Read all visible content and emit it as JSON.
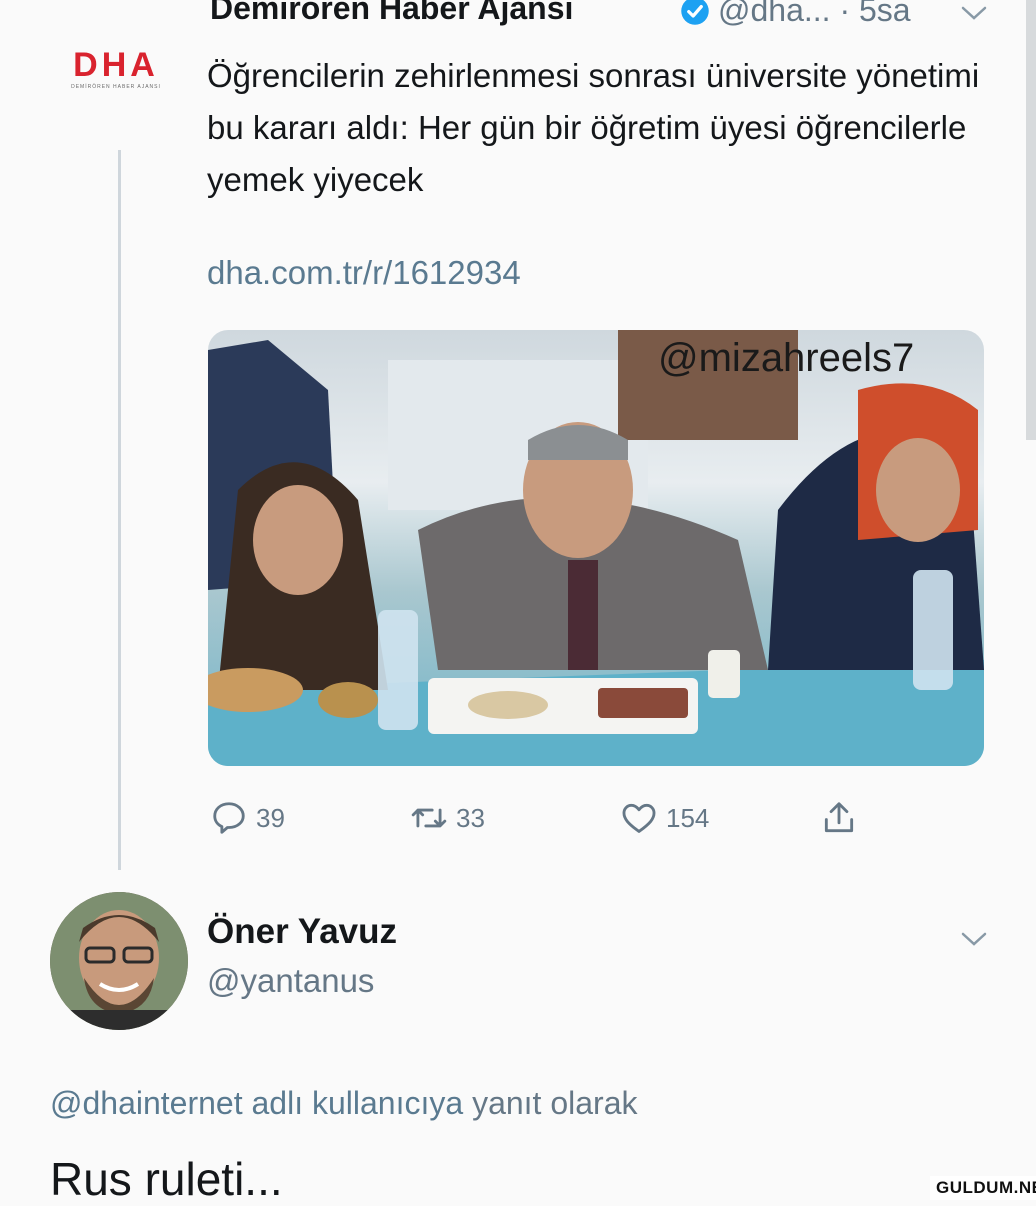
{
  "original_tweet": {
    "author_name": "Demirören Haber Ajansı",
    "handle": "@dha...",
    "time": "· 5sa",
    "text": "Öğrencilerin zehirlenmesi sonrası üniversite yönetimi bu kararı aldı: Her gün bir öğretim üyesi öğrencilerle yemek yiyecek",
    "link": "dha.com.tr/r/1612934",
    "logo_text": "DHA",
    "logo_subtext": "DEMİRÖREN HABER AJANSI",
    "watermark": "@mizahreels7",
    "actions": {
      "replies": "39",
      "retweets": "33",
      "likes": "154"
    }
  },
  "reply_tweet": {
    "author_name": "Öner Yavuz",
    "handle": "@yantanus",
    "reply_to_mention": "@dhainternet adlı kullanıcıya",
    "reply_to_suffix": " yanıt olarak",
    "text": "Rus ruleti..."
  },
  "site_tag": "GULDUM.NET",
  "colors": {
    "brand_red": "#d9232e",
    "verified_blue": "#1da1f2",
    "secondary_text": "#657786",
    "link": "#5a7a90"
  },
  "icons": [
    "verified-badge-icon",
    "chevron-down-icon",
    "reply-icon",
    "retweet-icon",
    "like-icon",
    "share-icon"
  ]
}
